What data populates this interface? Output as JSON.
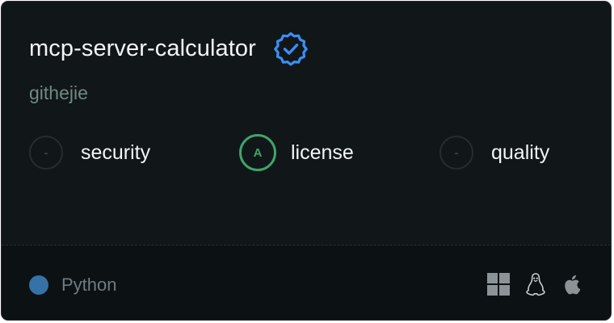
{
  "server": {
    "name": "mcp-server-calculator",
    "verified": true,
    "author": "githejie"
  },
  "badges": [
    {
      "grade": "-",
      "label": "security",
      "state": "none"
    },
    {
      "grade": "A",
      "label": "license",
      "state": "graded",
      "color": "#3fa46a"
    },
    {
      "grade": "-",
      "label": "quality",
      "state": "none"
    }
  ],
  "footer": {
    "language": "Python",
    "language_color": "#3572a5",
    "platforms": [
      "windows-icon",
      "linux-icon",
      "apple-icon"
    ]
  },
  "colors": {
    "card_bg": "#111618",
    "footer_bg": "#0c1113",
    "verified_blue": "#3b8ff5",
    "author": "#6e8a80"
  }
}
